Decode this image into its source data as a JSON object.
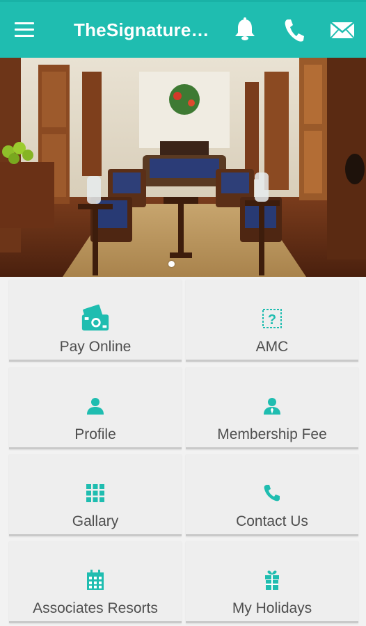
{
  "header": {
    "title": "TheSignature…",
    "background": "#1fbdb0",
    "icons": [
      "menu-icon",
      "bell-icon",
      "phone-icon",
      "mail-icon"
    ]
  },
  "banner": {
    "image": "hotel-lobby-photo",
    "page_indicator": {
      "current": 1
    }
  },
  "accent": "#1fbdb0",
  "tiles": [
    {
      "label": "Pay Online",
      "icon": "payment-icon"
    },
    {
      "label": "AMC",
      "icon": "question-icon"
    },
    {
      "label": "Profile",
      "icon": "person-icon"
    },
    {
      "label": "Membership Fee",
      "icon": "person-tie-icon"
    },
    {
      "label": "Gallary",
      "icon": "grid-icon"
    },
    {
      "label": "Contact Us",
      "icon": "phone-icon"
    },
    {
      "label": "Associates Resorts",
      "icon": "building-icon"
    },
    {
      "label": "My Holidays",
      "icon": "gift-icon"
    }
  ]
}
